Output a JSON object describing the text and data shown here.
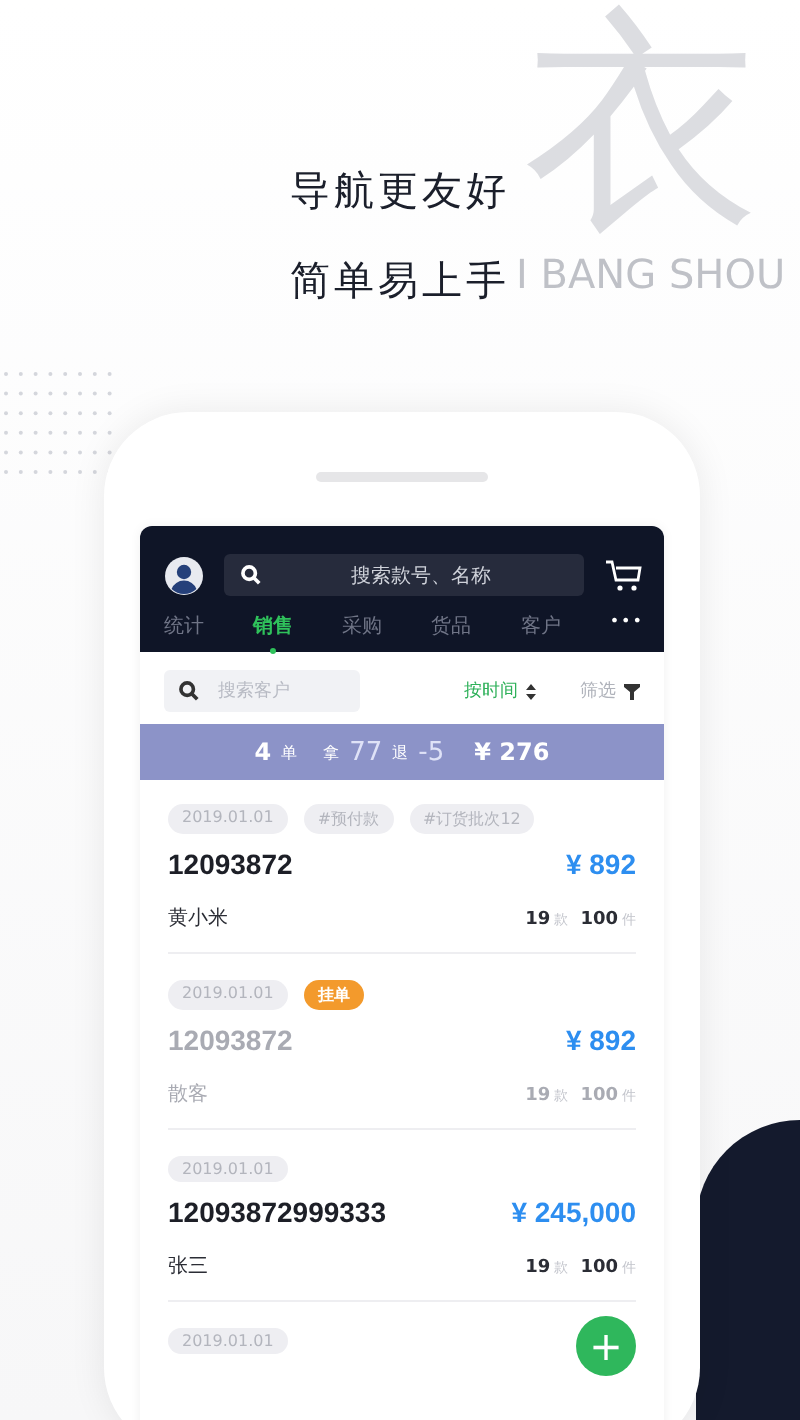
{
  "backdrop": {
    "big_character": "衣",
    "letters": "I BANG SHOU"
  },
  "headline": [
    "导航更友好",
    "简单易上手"
  ],
  "app": {
    "search": {
      "placeholder": "搜索款号、名称"
    },
    "tabs": [
      {
        "label": "统计",
        "selected": false
      },
      {
        "label": "销售",
        "selected": true
      },
      {
        "label": "采购",
        "selected": false
      },
      {
        "label": "货品",
        "selected": false
      },
      {
        "label": "客户",
        "selected": false
      }
    ],
    "more": "•••",
    "customer_search": {
      "placeholder": "搜索客户"
    },
    "sort": "按时间",
    "filter": "筛选",
    "summary": {
      "count": "4",
      "count_unit": "单",
      "take_label": "拿",
      "take": "77",
      "return_label": "退",
      "return": "-5",
      "total": "¥ 276"
    },
    "orders": [
      {
        "date": "2019.01.01",
        "tags": [
          {
            "text": "#预付款",
            "kind": "plain"
          },
          {
            "text": "#订货批次12",
            "kind": "plain"
          }
        ],
        "number": "12093872",
        "amount": "¥ 892",
        "customer": "黄小米",
        "styles": "19",
        "styles_unit": "款",
        "pieces": "100",
        "pieces_unit": "件",
        "muted": false
      },
      {
        "date": "2019.01.01",
        "tags": [
          {
            "text": "挂单",
            "kind": "status"
          }
        ],
        "number": "12093872",
        "amount": "¥ 892",
        "customer": "散客",
        "styles": "19",
        "styles_unit": "款",
        "pieces": "100",
        "pieces_unit": "件",
        "muted": true
      },
      {
        "date": "2019.01.01",
        "number": "12093872999333",
        "amount": "¥ 245,000",
        "customer": "张三",
        "styles": "19",
        "styles_unit": "款",
        "pieces": "100",
        "pieces_unit": "件",
        "muted": false
      },
      {
        "date": "2019.01.01"
      }
    ],
    "fab": "+"
  }
}
